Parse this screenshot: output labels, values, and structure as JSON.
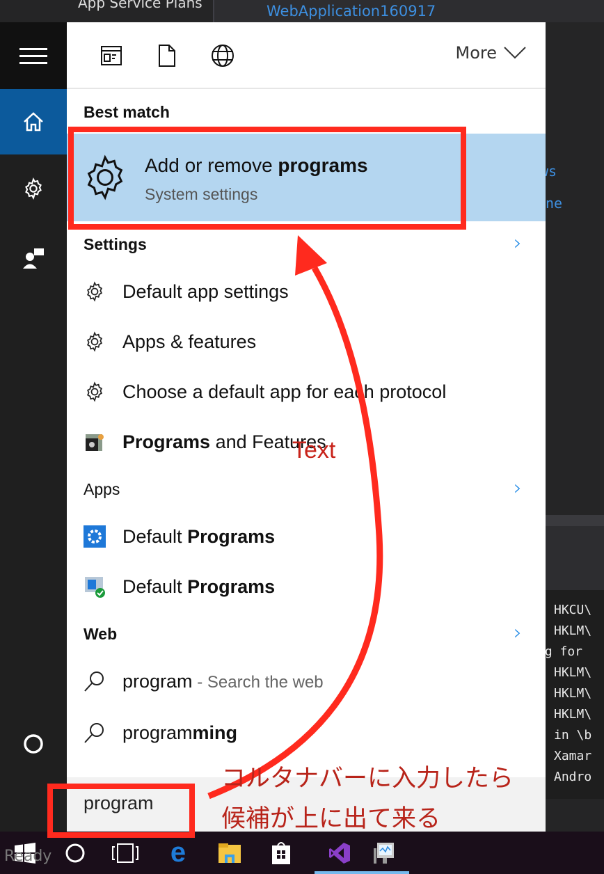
{
  "background": {
    "tree_item": "App Service Plans",
    "project_link": "WebApplication160917",
    "right_fragments": [
      "ws",
      "ne"
    ],
    "console_lines": [
      "HKCU\\",
      "HKLM\\",
      "ng for",
      "HKLM\\",
      "HKLM\\",
      "HKLM\\",
      "in \\b",
      "Xamar",
      "Andro"
    ],
    "status": "Ready"
  },
  "rail": {
    "items": [
      {
        "icon": "hamburger-icon"
      },
      {
        "icon": "home-icon",
        "active": true
      },
      {
        "icon": "gear-icon"
      },
      {
        "icon": "feedback-icon"
      },
      {
        "icon": "cortana-circle-icon"
      }
    ]
  },
  "header": {
    "filters": [
      "apps-filter-icon",
      "documents-filter-icon",
      "web-filter-icon"
    ],
    "more_label": "More"
  },
  "best_match": {
    "section_label": "Best match",
    "title_normal": "Add or remove ",
    "title_bold": "programs",
    "subtitle": "System settings"
  },
  "settings": {
    "section_label": "Settings",
    "items": [
      {
        "normal": "Default app settings",
        "bold": "",
        "after": ""
      },
      {
        "normal": "Apps & features",
        "bold": "",
        "after": ""
      },
      {
        "normal": "Choose a default app for each protocol",
        "bold": "",
        "after": ""
      },
      {
        "normal": "",
        "bold": "Programs",
        "after": " and Features"
      }
    ]
  },
  "apps": {
    "section_label": "Apps",
    "items": [
      {
        "normal": "Default ",
        "bold": "Programs"
      },
      {
        "normal": "Default ",
        "bold": "Programs"
      }
    ]
  },
  "web": {
    "section_label": "Web",
    "items": [
      {
        "normal": "program",
        "bold": "",
        "suffix": " - Search the web"
      },
      {
        "normal": "program",
        "bold": "ming",
        "suffix": ""
      }
    ]
  },
  "search": {
    "value": "program"
  },
  "annotations": {
    "arrow_label": "Text",
    "note_line1": "コルタナバーに入力したら",
    "note_line2": "候補が上に出て来る",
    "color": "#ff2a1e"
  },
  "taskbar": {
    "items": [
      "start-icon",
      "cortana-icon",
      "task-view-icon",
      "edge-icon",
      "file-explorer-icon",
      "store-icon",
      "visual-studio-icon",
      "performance-monitor-icon"
    ]
  },
  "colors": {
    "highlight": "#b4d6f0",
    "accent": "#1e88e5",
    "rail_active": "#0c5a9c"
  }
}
